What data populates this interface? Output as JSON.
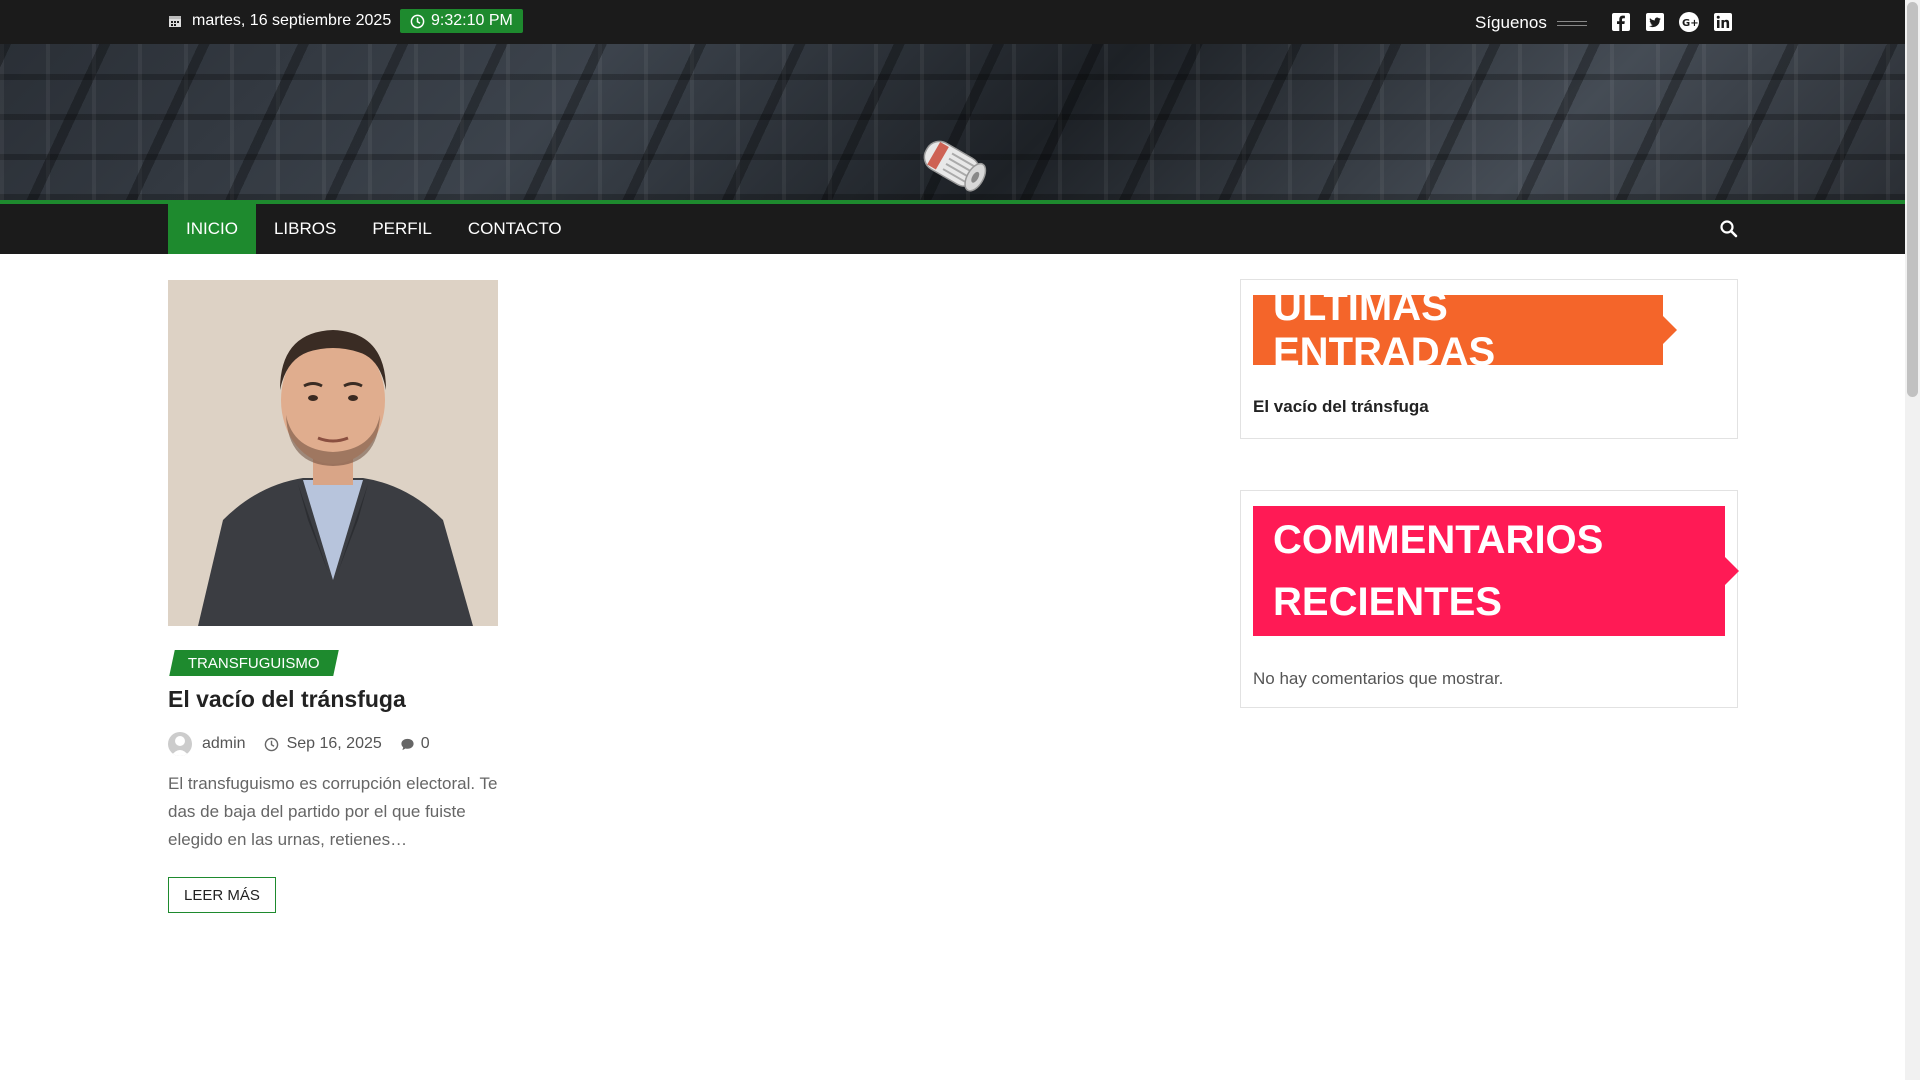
{
  "topbar": {
    "date": "martes, 16 septiembre 2025",
    "time": "9:32:10 PM",
    "follow_label": "Síguenos",
    "social_icons": [
      "facebook-icon",
      "twitter-icon",
      "google-plus-icon",
      "linkedin-icon"
    ]
  },
  "nav": {
    "items": [
      "INICIO",
      "LIBROS",
      "PERFIL",
      "CONTACTO"
    ],
    "active": "INICIO"
  },
  "post": {
    "category": "TRANSFUGUISMO",
    "title": "El vacío del tránsfuga",
    "author": "admin",
    "date": "Sep 16, 2025",
    "comments": "0",
    "excerpt": "El transfuguismo es corrupción electoral. Te das de baja del partido por el que fuiste elegido en las urnas, retienes…",
    "read_more": "LEER MÁS"
  },
  "sidebar": {
    "latest_title": "ÚLTIMAS ENTRADAS",
    "latest_items": [
      "El vacío del tránsfuga"
    ],
    "comments_title": "COMMENTARIOS RECIENTES",
    "comments_empty": "No hay comentarios que mostrar."
  },
  "colors": {
    "accent": "#1e8a2e",
    "topbar": "#1b1b1b",
    "latest_title_bg": "#f4652a",
    "comments_title_bg": "#ff1a55"
  }
}
